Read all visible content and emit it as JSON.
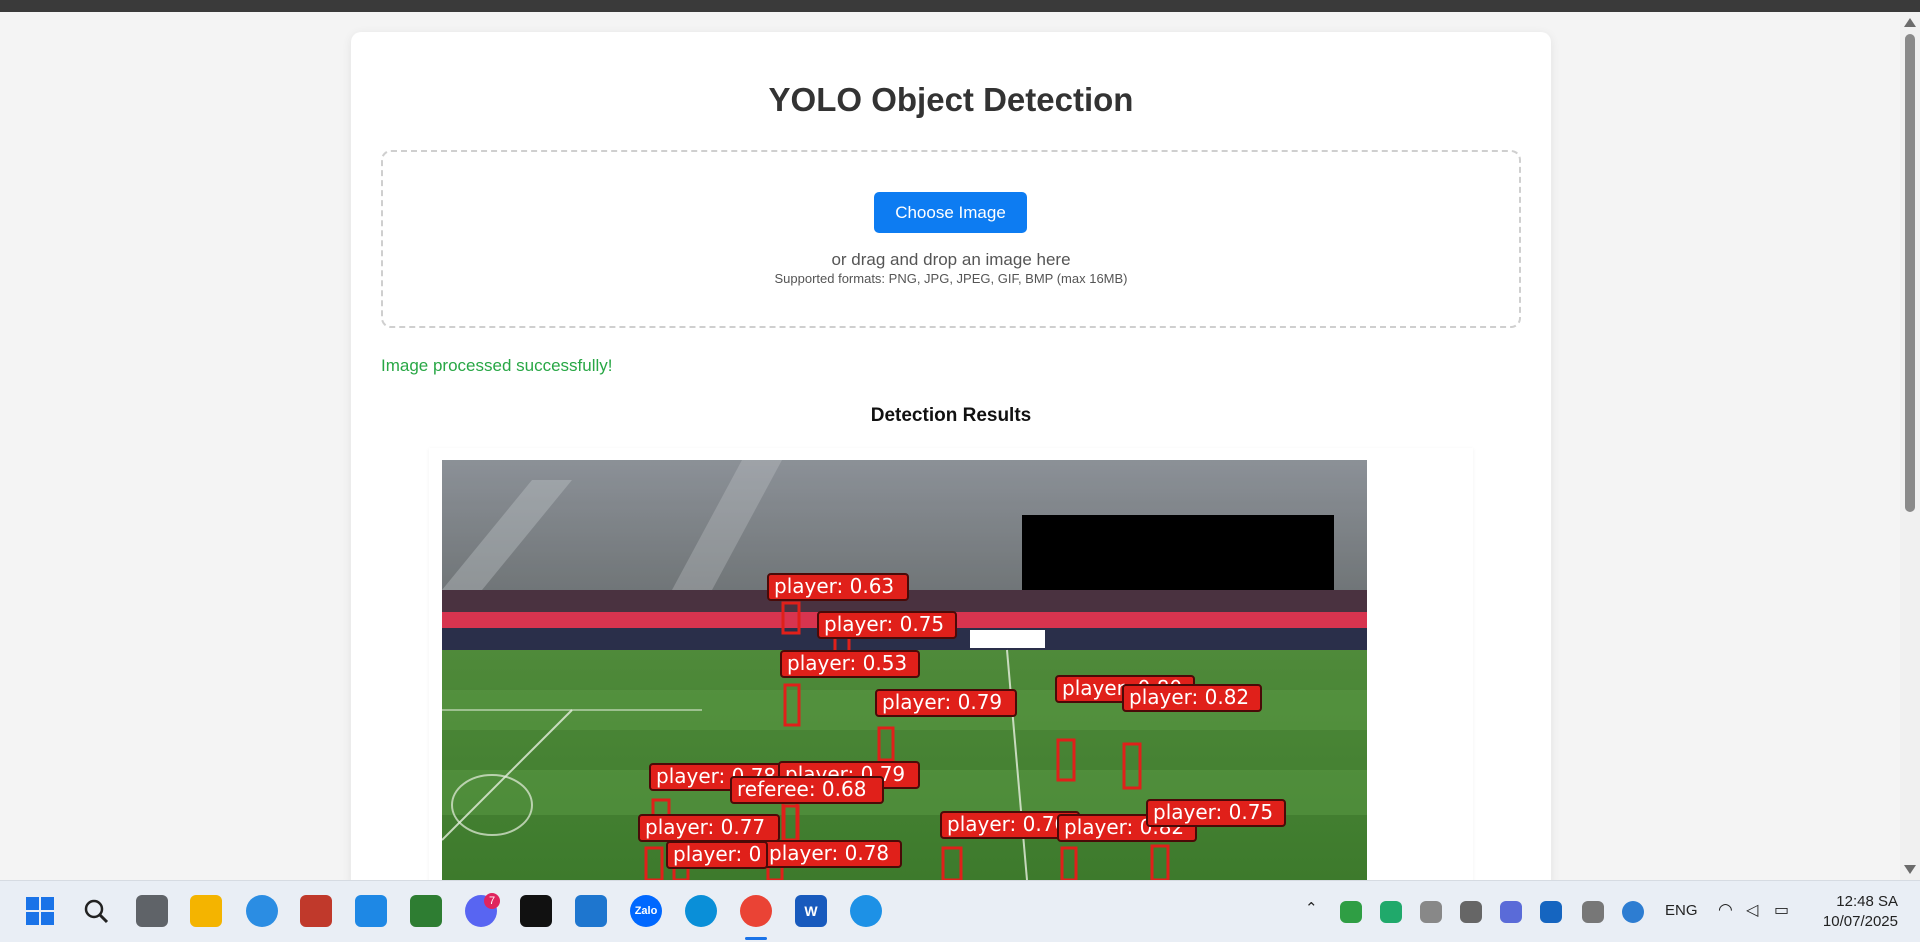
{
  "page": {
    "title": "YOLO Object Detection",
    "choose_button": "Choose Image",
    "drop_hint": "or drag and drop an image here",
    "formats": "Supported formats: PNG, JPG, JPEG, GIF, BMP (max 16MB)",
    "status": "Image processed successfully!",
    "results_title": "Detection Results"
  },
  "detections": [
    {
      "label": "player: 0.63"
    },
    {
      "label": "player: 0.75"
    },
    {
      "label": "player: 0.53"
    },
    {
      "label": "player: 0.79"
    },
    {
      "label": "player: 0.80"
    },
    {
      "label": "player: 0.82"
    },
    {
      "label": "player: 0.78"
    },
    {
      "label": "player: 0.79"
    },
    {
      "label": "referee: 0.68"
    },
    {
      "label": "player: 0.77"
    },
    {
      "label": "player: 0.76"
    },
    {
      "label": "player: 0.82"
    },
    {
      "label": "player: 0.75"
    },
    {
      "label": "player: 0.78"
    },
    {
      "label": "player: 0"
    }
  ],
  "taskbar": {
    "lang": "ENG",
    "time": "12:48 SA",
    "date": "10/07/2025",
    "discord_badge": "7",
    "zalo_label": "Zalo",
    "word_label": "W",
    "apps": [
      "start-icon",
      "search-icon",
      "task-view-icon",
      "file-explorer-icon",
      "settings-globe-icon",
      "snipping-tool-icon",
      "notepad-icon",
      "slides-icon",
      "discord-icon",
      "capcut-icon",
      "vscode-icon",
      "zalo-icon",
      "edge-icon",
      "chrome-icon",
      "word-icon",
      "docker-icon"
    ]
  },
  "colors": {
    "accent": "#0d7cf2",
    "success": "#28a745",
    "detection_box": "#e0201a"
  }
}
